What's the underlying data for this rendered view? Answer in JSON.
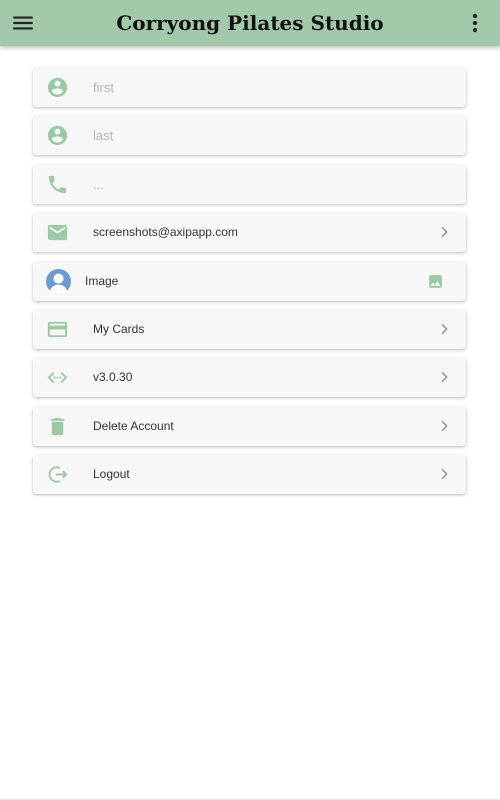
{
  "app": {
    "title": "Corryong Pilates Studio"
  },
  "colors": {
    "header_bg": "#a2c9a9",
    "icon_green": "#9dc8a5",
    "avatar_blue": "#6d9bd1"
  },
  "profile": {
    "first_placeholder": "first",
    "last_placeholder": "last",
    "phone_placeholder": "...",
    "email": "screenshots@axipapp.com",
    "image_label": "Image",
    "cards_label": "My Cards",
    "version": "v3.0.30",
    "delete_label": "Delete Account",
    "logout_label": "Logout"
  },
  "icons": {
    "menu": "menu-icon",
    "more": "more-vert-icon",
    "person": "account-circle-icon",
    "phone": "phone-icon",
    "email": "email-icon",
    "avatar": "avatar-icon",
    "image": "image-icon",
    "card": "credit-card-icon",
    "code": "code-icon",
    "delete": "trash-icon",
    "logout": "logout-icon",
    "chevron": "chevron-right-icon"
  }
}
